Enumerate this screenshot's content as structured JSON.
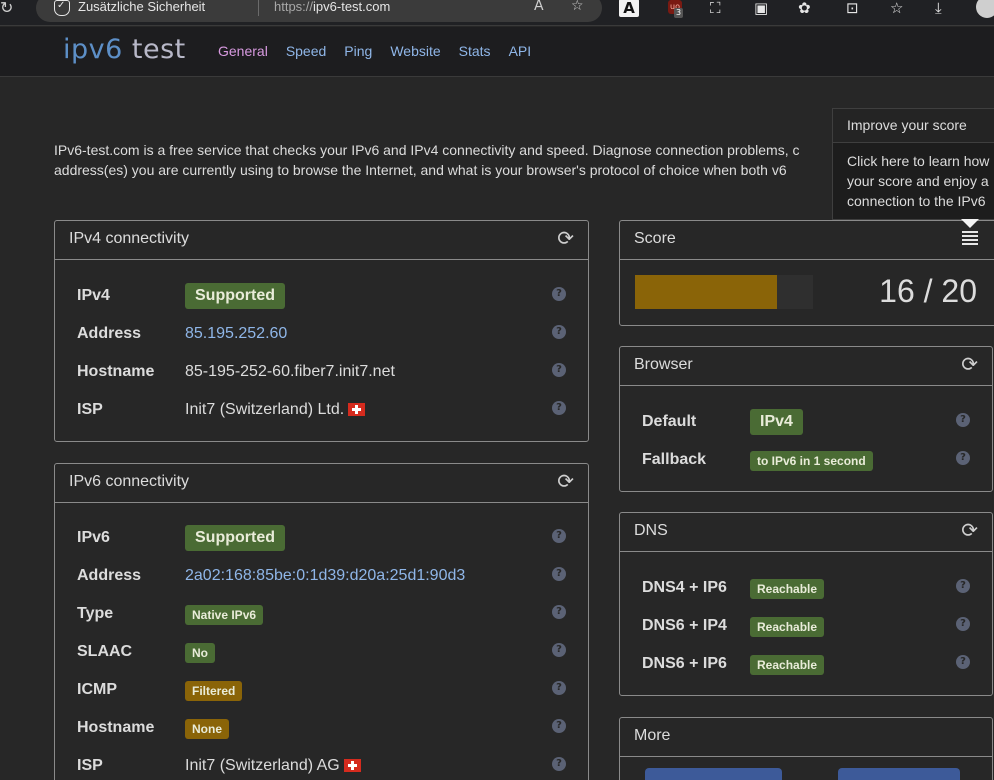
{
  "browser": {
    "security_label": "Zusätzliche Sicherheit",
    "url_prefix": "https://",
    "url_host": "ipv6-test.com",
    "extension_badge_count": "3"
  },
  "site": {
    "logo_part1": "ipv6",
    "logo_part2": "test",
    "nav": [
      "General",
      "Speed",
      "Ping",
      "Website",
      "Stats",
      "API"
    ],
    "active_nav": "General",
    "intro_line1": "IPv6-test.com is a free service that checks your IPv6 and IPv4 connectivity and speed. Diagnose connection problems, c",
    "intro_line2": "address(es) you are currently using to browse the Internet, and what is your browser's protocol of choice when both v6"
  },
  "popover": {
    "title": "Improve your score",
    "line1": "Click here to learn how",
    "line2": "your score and enjoy a",
    "line3": "connection to the IPv6"
  },
  "ipv4": {
    "title": "IPv4 connectivity",
    "rows": [
      {
        "label": "IPv4",
        "value": "Supported"
      },
      {
        "label": "Address",
        "value": "85.195.252.60"
      },
      {
        "label": "Hostname",
        "value": "85-195-252-60.fiber7.init7.net"
      },
      {
        "label": "ISP",
        "value": "Init7 (Switzerland) Ltd."
      }
    ]
  },
  "ipv6": {
    "title": "IPv6 connectivity",
    "rows": [
      {
        "label": "IPv6",
        "value": "Supported"
      },
      {
        "label": "Address",
        "value": "2a02:168:85be:0:1d39:d20a:25d1:90d3"
      },
      {
        "label": "Type",
        "value": "Native IPv6"
      },
      {
        "label": "SLAAC",
        "value": "No"
      },
      {
        "label": "ICMP",
        "value": "Filtered"
      },
      {
        "label": "Hostname",
        "value": "None"
      },
      {
        "label": "ISP",
        "value": "Init7 (Switzerland) AG"
      }
    ]
  },
  "score": {
    "title": "Score",
    "value_text": "16 / 20",
    "fraction": 0.8
  },
  "browser_panel": {
    "title": "Browser",
    "rows": [
      {
        "label": "Default",
        "value": "IPv4"
      },
      {
        "label": "Fallback",
        "value": "to IPv6 in 1 second"
      }
    ]
  },
  "dns": {
    "title": "DNS",
    "rows": [
      {
        "label": "DNS4 + IP6",
        "value": "Reachable"
      },
      {
        "label": "DNS6 + IP4",
        "value": "Reachable"
      },
      {
        "label": "DNS6 + IP6",
        "value": "Reachable"
      }
    ]
  },
  "more": {
    "title": "More"
  },
  "colors": {
    "success": "#4a6b34",
    "warning": "#8a6408",
    "link": "#8fb6e8",
    "nav_active": "#d89ae0",
    "help_icon": "#5b6275"
  },
  "icons": {
    "refresh": "refresh-icon",
    "help": "help-icon",
    "score_list": "list-icon",
    "flag": "swiss-flag-icon"
  }
}
